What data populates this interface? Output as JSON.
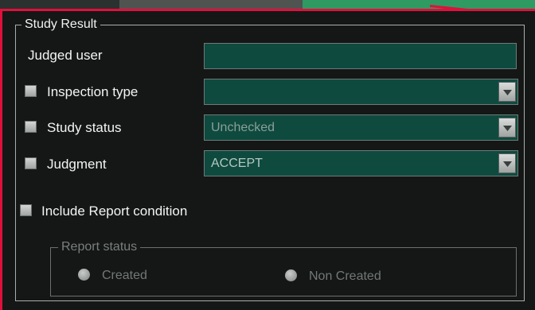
{
  "panel": {
    "title": "Study Result",
    "judged_user": {
      "label": "Judged user",
      "value": ""
    },
    "inspection_type": {
      "label": "Inspection type",
      "value": "",
      "checked": false
    },
    "study_status": {
      "label": "Study status",
      "value": "Unchecked",
      "checked": false
    },
    "judgment": {
      "label": "Judgment",
      "value": "ACCEPT",
      "checked": false
    },
    "include_report": {
      "label": "Include Report condition",
      "checked": false
    },
    "report_status": {
      "title": "Report status",
      "options": [
        {
          "label": "Created",
          "selected": false
        },
        {
          "label": "Non Created",
          "selected": false
        }
      ]
    }
  }
}
